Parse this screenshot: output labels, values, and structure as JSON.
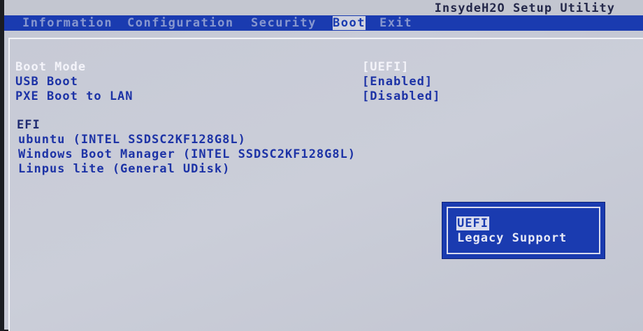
{
  "app_title": "InsydeH2O Setup Utility",
  "tabs": [
    {
      "label": "Information"
    },
    {
      "label": "Configuration"
    },
    {
      "label": "Security"
    },
    {
      "label": "Boot"
    },
    {
      "label": "Exit"
    }
  ],
  "active_tab": "Boot",
  "settings": [
    {
      "label": "Boot Mode",
      "value": "[UEFI]"
    },
    {
      "label": "USB Boot",
      "value": "[Enabled]"
    },
    {
      "label": "PXE Boot to LAN",
      "value": "[Disabled]"
    }
  ],
  "efi_section": {
    "heading": "EFI",
    "items": [
      "ubuntu (INTEL SSDSC2KF128G8L)",
      "Windows Boot Manager (INTEL SSDSC2KF128G8L)",
      "Linpus lite (General UDisk)"
    ]
  },
  "popup": {
    "options": [
      "UEFI",
      "Legacy Support"
    ],
    "selected": "UEFI"
  },
  "colors": {
    "menubar": "#1a3bb0",
    "background": "#c7cad6",
    "text": "#1d33a6",
    "highlight_text": "#f4f4fa"
  }
}
